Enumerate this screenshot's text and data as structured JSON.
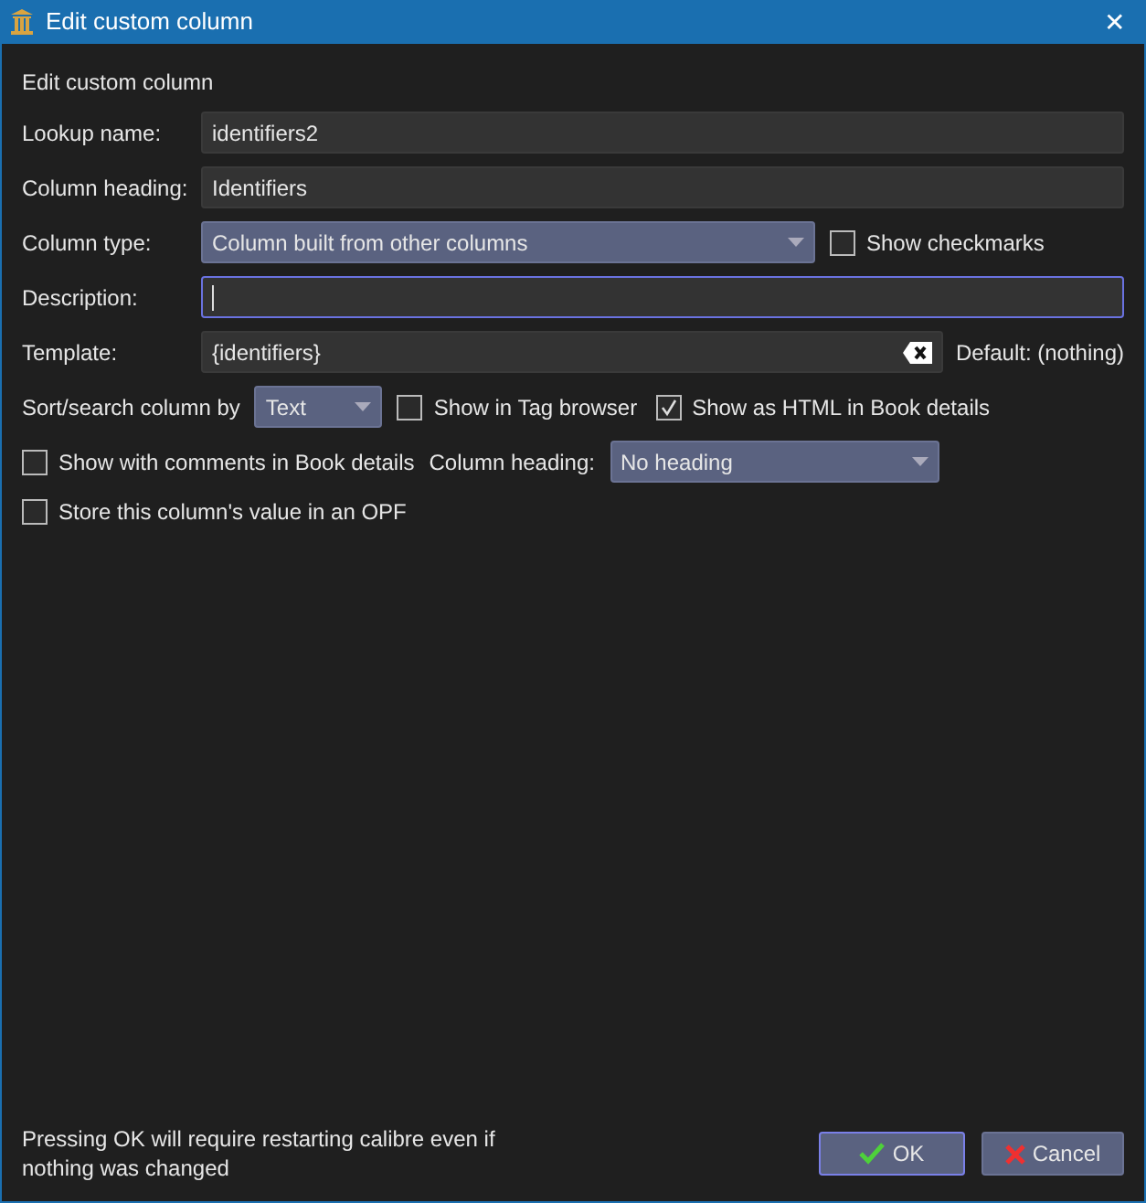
{
  "window": {
    "title": "Edit custom column",
    "close": "✕"
  },
  "heading": "Edit custom column",
  "fields": [
    {
      "label": "Lookup name:",
      "value": "identifiers2"
    },
    {
      "label": "Column heading:",
      "value": "Identifiers"
    }
  ],
  "column_type": {
    "label": "Column type:",
    "value": "Column built from other columns",
    "checkbox": {
      "label": "Show checkmarks",
      "checked": false
    }
  },
  "description": {
    "label": "Description:",
    "focused": true
  },
  "template": {
    "label": "Template:",
    "value": "{identifiers}",
    "default": "Default: (nothing)"
  },
  "sort_row": {
    "label": "Sort/search column by",
    "value": "Text",
    "checkboxes": [
      {
        "label": "Show in Tag browser",
        "checked": false
      },
      {
        "label": "Show as HTML in Book details",
        "checked": true
      }
    ]
  },
  "comments_row": {
    "checkbox": {
      "label": "Show with comments in Book details",
      "checked": false
    },
    "heading_label": "Column heading:",
    "heading_value": "No heading"
  },
  "opf_checkbox": {
    "label": "Store this column's value in an OPF",
    "checked": false
  },
  "footer": {
    "note": "Pressing OK will require restarting calibre even if nothing was changed",
    "buttons": [
      {
        "label": "OK",
        "kind": "ok",
        "selected": true
      },
      {
        "label": "Cancel",
        "kind": "cancel",
        "selected": false
      }
    ]
  }
}
